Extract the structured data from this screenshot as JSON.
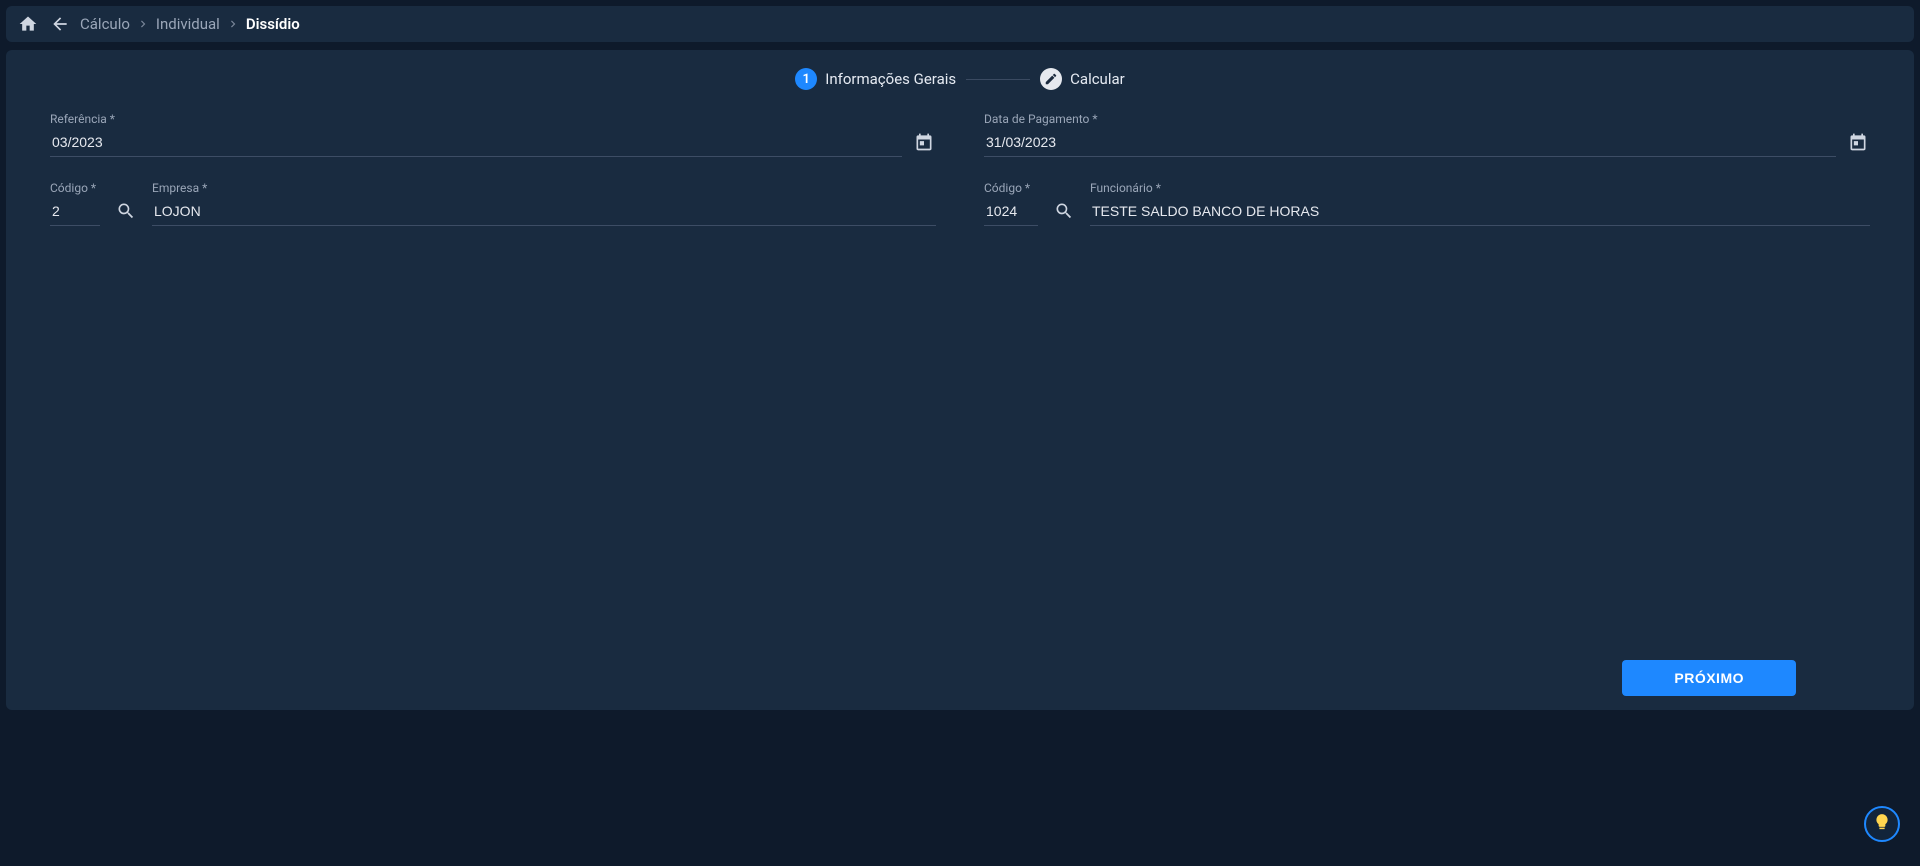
{
  "breadcrumbs": {
    "items": [
      "Cálculo",
      "Individual",
      "Dissídio"
    ]
  },
  "stepper": {
    "step1": {
      "number": "1",
      "label": "Informações Gerais"
    },
    "step2": {
      "label": "Calcular"
    }
  },
  "form": {
    "referencia": {
      "label": "Referência *",
      "value": "03/2023"
    },
    "dataPagamento": {
      "label": "Data de Pagamento *",
      "value": "31/03/2023"
    },
    "empresaCodigo": {
      "label": "Código *",
      "value": "2"
    },
    "empresa": {
      "label": "Empresa *",
      "value": "LOJON"
    },
    "funcionarioCodigo": {
      "label": "Código *",
      "value": "1024"
    },
    "funcionario": {
      "label": "Funcionário *",
      "value": "TESTE SALDO BANCO DE HORAS"
    }
  },
  "actions": {
    "next": "PRÓXIMO"
  },
  "colors": {
    "accent": "#1e88ff",
    "panel": "#192b40",
    "background": "#0e1a2b"
  }
}
